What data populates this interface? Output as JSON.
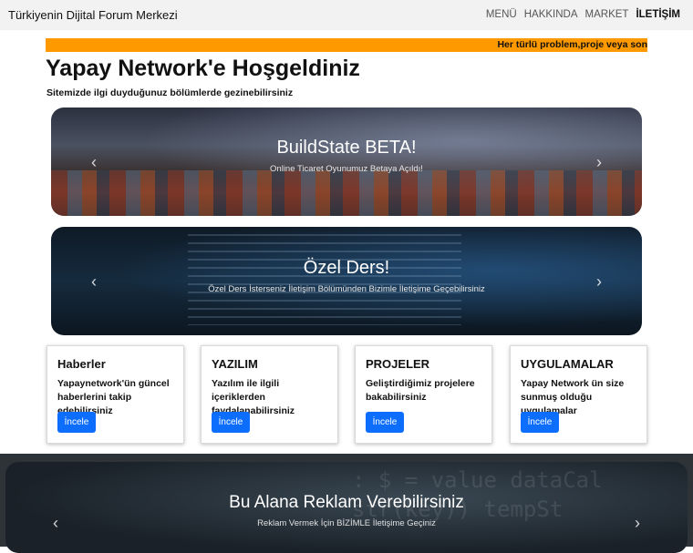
{
  "navbar": {
    "brand": "Türkiyenin Dijital Forum Merkezi",
    "links": [
      "MENÜ",
      "HAKKINDA",
      "MARKET",
      "İLETİŞİM"
    ]
  },
  "ticker": {
    "text": "Her türlü problem,proje veya son"
  },
  "welcome": {
    "title": "Yapay Network'e Hoşgeldiniz",
    "subtitle": "Sitemizde ilgi duyduğunuz bölümlerde gezinebilirsiniz"
  },
  "carousel": [
    {
      "title": "BuildState BETA!",
      "caption": "Online Ticaret Oyunumuz Betaya Açıldı!"
    },
    {
      "title": "Özel Ders!",
      "caption": "Özel Ders İsterseniz İletişim Bölümünden Bizimle İletişime Geçebilirsiniz"
    }
  ],
  "arrows": {
    "prev": "‹",
    "next": "›"
  },
  "cards": [
    {
      "title": "Haberler",
      "text": "Yapaynetwork'ün güncel haberlerini takip edebilirsiniz",
      "button": "İncele"
    },
    {
      "title": "YAZILIM",
      "text": "Yazılım ile ilgili içeriklerden faydalanabilirsiniz",
      "button": "İncele"
    },
    {
      "title": "PROJELER",
      "text": "Geliştirdiğimiz projelere bakabilirsiniz",
      "button": "İncele"
    },
    {
      "title": "UYGULAMALAR",
      "text": "Yapay Network ün size sunmuş olduğu uygulamalar",
      "button": "İncele"
    }
  ],
  "ad": {
    "title": "Bu Alana Reklam Verebilirsiniz",
    "caption": "Reklam Vermek İçin BİZİMLE İletişime Geçiniz"
  },
  "colors": {
    "ticker": "#ff9900",
    "button": "#0d6efd",
    "navbar": "#f2f2f2"
  }
}
